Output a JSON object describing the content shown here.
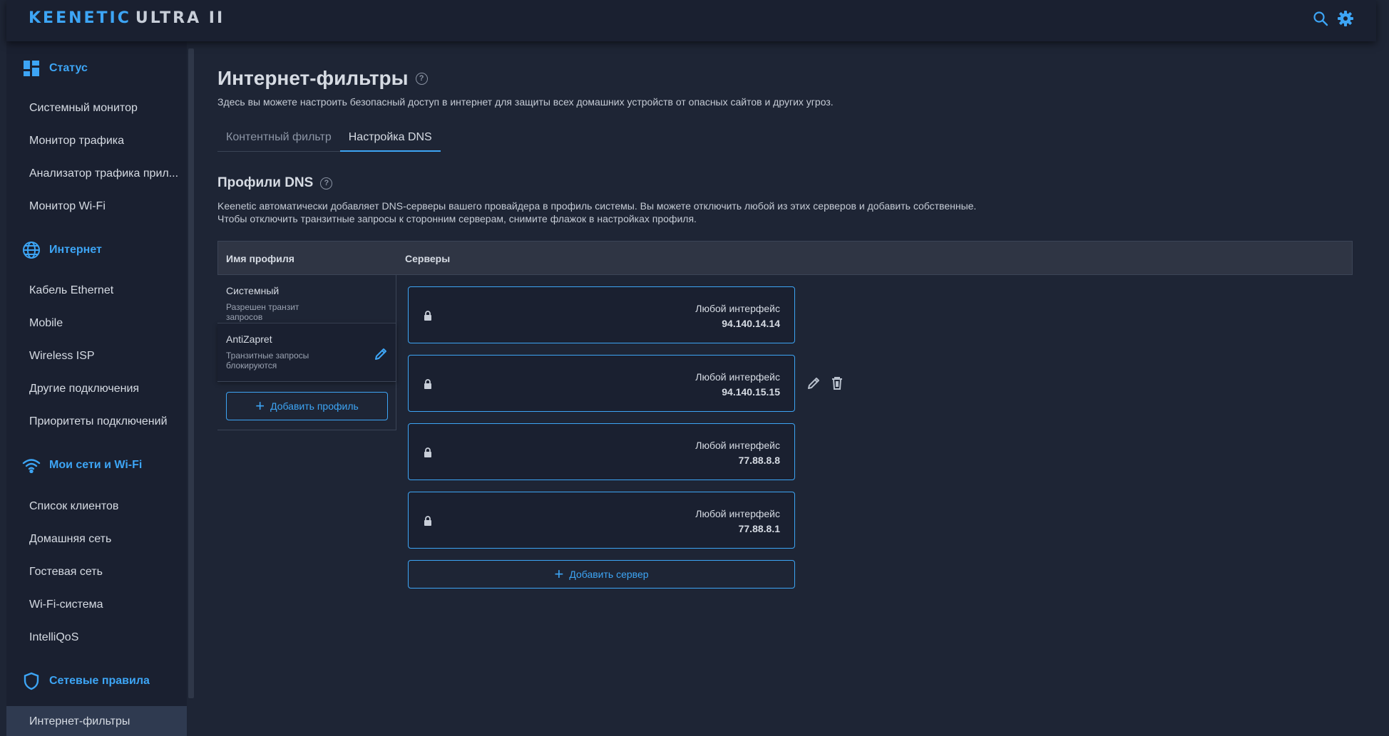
{
  "header": {
    "brand": "KEENETIC",
    "model": "ULTRA II",
    "icons": [
      "search-icon",
      "settings-gear-icon"
    ],
    "accent_color": "#3da5f5"
  },
  "sidebar": {
    "sections": [
      {
        "label": "Статус",
        "icon": "dashboard-icon"
      },
      {
        "label": "Интернет",
        "icon": "globe-icon"
      },
      {
        "label": "Мои сети и Wi-Fi",
        "icon": "wifi-icon"
      },
      {
        "label": "Сетевые правила",
        "icon": "shield-icon"
      }
    ],
    "items": [
      {
        "label": "Системный монитор"
      },
      {
        "label": "Монитор трафика"
      },
      {
        "label": "Анализатор трафика прил..."
      },
      {
        "label": "Монитор Wi-Fi"
      },
      {
        "label": "Кабель Ethernet"
      },
      {
        "label": "Mobile"
      },
      {
        "label": "Wireless ISP"
      },
      {
        "label": "Другие подключения"
      },
      {
        "label": "Приоритеты подключений"
      },
      {
        "label": "Список клиентов"
      },
      {
        "label": "Домашняя сеть"
      },
      {
        "label": "Гостевая сеть"
      },
      {
        "label": "Wi-Fi-система"
      },
      {
        "label": "IntelliQoS"
      },
      {
        "label": "Интернет-фильтры"
      }
    ],
    "active_item": "Интернет-фильтры"
  },
  "page": {
    "title": "Интернет-фильтры",
    "description": "Здесь вы можете настроить безопасный доступ в интернет для защиты всех домашних устройств от опасных сайтов и других угроз.",
    "tabs": [
      {
        "label": "Контентный фильтр",
        "active": false
      },
      {
        "label": "Настройка DNS",
        "active": true
      }
    ]
  },
  "dns": {
    "title": "Профили DNS",
    "description_line1": "Keenetic автоматически добавляет DNS-серверы вашего провайдера в профиль системы. Вы можете отключить любой из этих серверов и добавить собственные.",
    "description_line2": "Чтобы отключить транзитные запросы к сторонним серверам, снимите флажок в настройках профиля.",
    "columns": {
      "profile": "Имя профиля",
      "servers": "Серверы"
    },
    "profiles": [
      {
        "name": "Системный",
        "status": "Разрешен транзит запросов"
      },
      {
        "name": "AntiZapret",
        "status": "Транзитные запросы блокируются"
      }
    ],
    "add_profile_label": "Добавить профиль",
    "servers": [
      {
        "interface": "Любой интерфейс",
        "ip": "94.140.14.14"
      },
      {
        "interface": "Любой интерфейс",
        "ip": "94.140.15.15"
      },
      {
        "interface": "Любой интерфейс",
        "ip": "77.88.8.8"
      },
      {
        "interface": "Любой интерфейс",
        "ip": "77.88.8.1"
      }
    ],
    "add_server_label": "Добавить сервер"
  }
}
